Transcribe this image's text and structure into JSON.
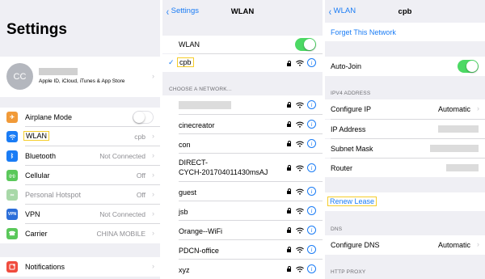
{
  "panel1": {
    "title": "Settings",
    "account": {
      "initials": "CC",
      "subtitle": "Apple ID, iCloud, iTunes & App Store"
    },
    "rows": [
      {
        "label": "Airplane Mode",
        "value": "",
        "icon": "airplane-icon",
        "color": "#f19a38"
      },
      {
        "label": "WLAN",
        "value": "cpb",
        "icon": "wifi-icon",
        "color": "#1a7cf5"
      },
      {
        "label": "Bluetooth",
        "value": "Not Connected",
        "icon": "bluetooth-icon",
        "color": "#1a7cf5"
      },
      {
        "label": "Cellular",
        "value": "Off",
        "icon": "cellular-icon",
        "color": "#5ac85a"
      },
      {
        "label": "Personal Hotspot",
        "value": "Off",
        "icon": "hotspot-icon",
        "color": "#a8d8a8"
      },
      {
        "label": "VPN",
        "value": "Not Connected",
        "icon": "vpn-icon",
        "color": "#2c6ed9"
      },
      {
        "label": "Carrier",
        "value": "CHINA MOBILE",
        "icon": "phone-icon",
        "color": "#5ac85a"
      }
    ],
    "notifications": {
      "label": "Notifications",
      "icon": "notifications-icon",
      "color": "#f04c3e"
    },
    "vpn_badge": "VPN"
  },
  "panel2": {
    "back": "Settings",
    "title": "WLAN",
    "wlan_label": "WLAN",
    "connected": "cpb",
    "choose_header": "CHOOSE A NETWORK...",
    "networks": [
      {
        "name": ""
      },
      {
        "name": "cinecreator"
      },
      {
        "name": "con"
      },
      {
        "name": "DIRECT-\nCYCH-201704011430msAJ"
      },
      {
        "name": "guest"
      },
      {
        "name": "jsb"
      },
      {
        "name": "Orange--WiFi"
      },
      {
        "name": "PDCN-office"
      },
      {
        "name": "xyz"
      }
    ],
    "info_glyph": "i"
  },
  "panel3": {
    "back": "WLAN",
    "title": "cpb",
    "forget": "Forget This Network",
    "autojoin": "Auto-Join",
    "ipv4_header": "IPV4 ADDRESS",
    "configure_ip": {
      "label": "Configure IP",
      "value": "Automatic"
    },
    "ip_address": "IP Address",
    "subnet_mask": "Subnet Mask",
    "router": "Router",
    "renew": "Renew Lease",
    "dns_header": "DNS",
    "configure_dns": {
      "label": "Configure DNS",
      "value": "Automatic"
    },
    "proxy_header": "HTTP PROXY"
  },
  "colors": {
    "accent": "#1a7cf5",
    "toggle_on": "#4cd964",
    "highlight": "#f5cd2a"
  }
}
